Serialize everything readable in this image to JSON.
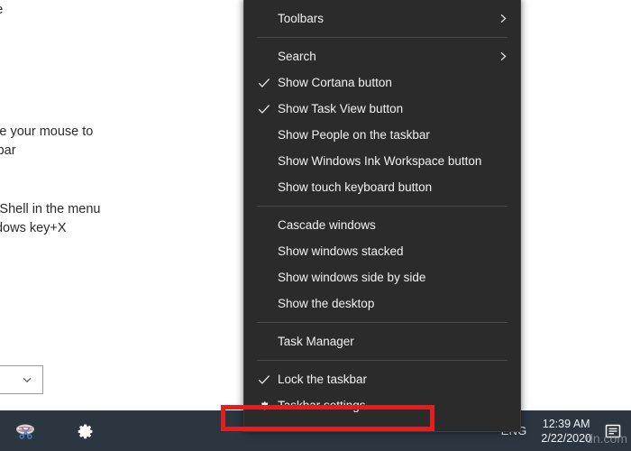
{
  "background": {
    "lines": [
      "le",
      "move your mouse to",
      "askbar",
      "owerShell in the menu",
      "Windows key+X"
    ],
    "dropdown": {
      "icon": "chevron-down-icon",
      "value": ""
    }
  },
  "context_menu": {
    "groups": [
      {
        "items": [
          {
            "label": "Toolbars",
            "submenu": true,
            "checked": false,
            "icon": null
          }
        ]
      },
      {
        "items": [
          {
            "label": "Search",
            "submenu": true,
            "checked": false,
            "icon": null
          },
          {
            "label": "Show Cortana button",
            "submenu": false,
            "checked": true,
            "icon": null
          },
          {
            "label": "Show Task View button",
            "submenu": false,
            "checked": true,
            "icon": null
          },
          {
            "label": "Show People on the taskbar",
            "submenu": false,
            "checked": false,
            "icon": null
          },
          {
            "label": "Show Windows Ink Workspace button",
            "submenu": false,
            "checked": false,
            "icon": null
          },
          {
            "label": "Show touch keyboard button",
            "submenu": false,
            "checked": false,
            "icon": null
          }
        ]
      },
      {
        "items": [
          {
            "label": "Cascade windows",
            "submenu": false,
            "checked": false,
            "icon": null
          },
          {
            "label": "Show windows stacked",
            "submenu": false,
            "checked": false,
            "icon": null
          },
          {
            "label": "Show windows side by side",
            "submenu": false,
            "checked": false,
            "icon": null
          },
          {
            "label": "Show the desktop",
            "submenu": false,
            "checked": false,
            "icon": null
          }
        ]
      },
      {
        "items": [
          {
            "label": "Task Manager",
            "submenu": false,
            "checked": false,
            "icon": null
          }
        ]
      },
      {
        "items": [
          {
            "label": "Lock the taskbar",
            "submenu": false,
            "checked": true,
            "icon": null
          },
          {
            "label": "Taskbar settings",
            "submenu": false,
            "checked": false,
            "icon": "gear-icon"
          }
        ]
      }
    ]
  },
  "highlight": {
    "target_label": "Taskbar settings",
    "color": "#e31e1e"
  },
  "taskbar": {
    "icons": [
      {
        "name": "snipping-tool-icon",
        "label": "Snipping Tool"
      },
      {
        "name": "settings-gear-icon",
        "label": "Settings"
      }
    ],
    "tray": {
      "language": "ENG",
      "time": "12:39 AM",
      "date": "2/22/2020",
      "action_center_icon": "notification-icon"
    }
  },
  "watermark": {
    "text": "dn.com"
  },
  "colors": {
    "menu_bg": "#2b2b2b",
    "menu_text": "#f2f2f2",
    "taskbar_bg": "#2c3641",
    "highlight_red": "#e31e1e",
    "page_bg": "#ffffff"
  }
}
